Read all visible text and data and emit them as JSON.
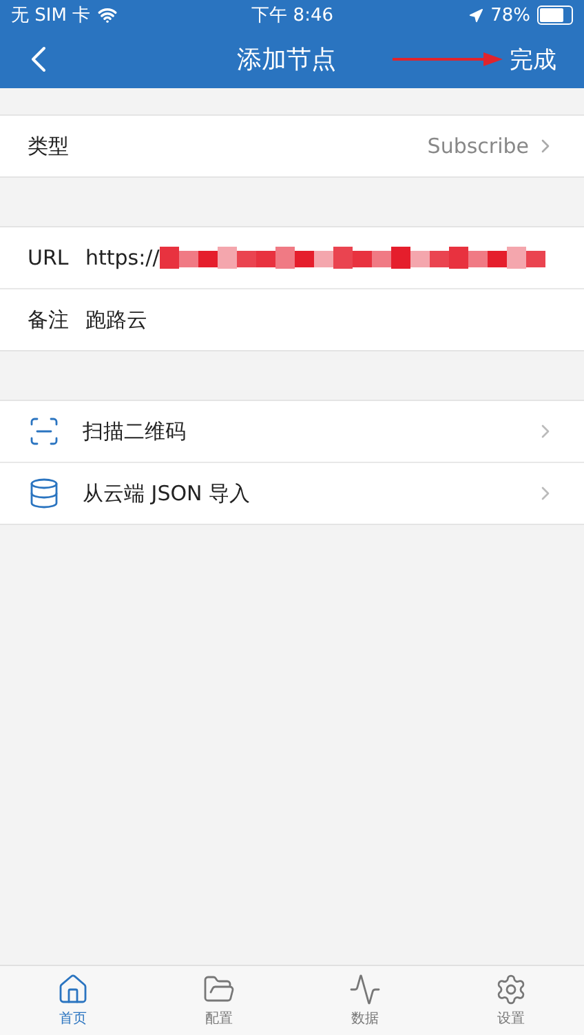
{
  "status_bar": {
    "carrier": "无 SIM 卡",
    "time": "下午 8:46",
    "battery": "78%"
  },
  "nav": {
    "title": "添加节点",
    "action": "完成"
  },
  "type_row": {
    "label": "类型",
    "value": "Subscribe"
  },
  "fields": [
    {
      "label": "URL",
      "value": "https://",
      "redacted": true
    },
    {
      "label": "备注",
      "value": "跑路云",
      "redacted": false
    }
  ],
  "actions": [
    {
      "kind": "scan",
      "label": "扫描二维码"
    },
    {
      "kind": "cloud",
      "label": "从云端 JSON 导入"
    }
  ],
  "tab_bar": [
    {
      "kind": "home",
      "label": "首页",
      "selected": true
    },
    {
      "kind": "folder",
      "label": "配置",
      "selected": false
    },
    {
      "kind": "pulse",
      "label": "数据",
      "selected": false
    },
    {
      "kind": "gear",
      "label": "设置",
      "selected": false
    }
  ]
}
